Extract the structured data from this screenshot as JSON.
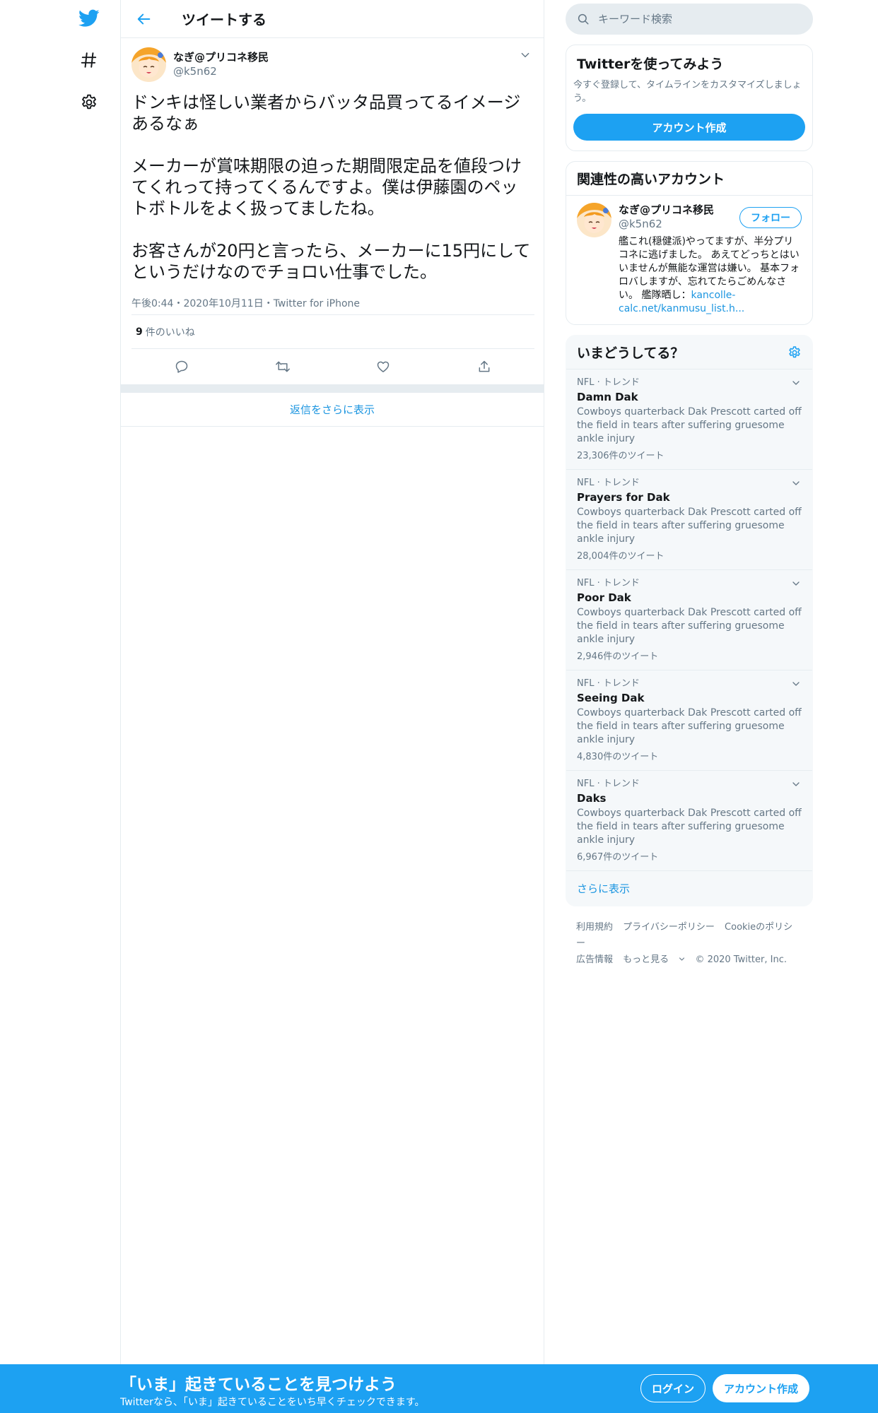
{
  "icons": {
    "twitter": "twitter-bird-icon",
    "explore": "hashtag-icon",
    "settings": "gear-icon"
  },
  "colors": {
    "brand": "#1da1f2",
    "link": "#1b95e0",
    "secondary_text": "#657786",
    "border": "#e6ecf0"
  },
  "header": {
    "title": "ツイートする"
  },
  "tweet": {
    "author_name": "なぎ@プリコネ移民",
    "author_handle": "@k5n62",
    "text": "ドンキは怪しい業者からバッタ品買ってるイメージあるなぁ\n\nメーカーが賞味期限の迫った期間限定品を値段つけてくれって持ってくるんですよ。僕は伊藤園のペットボトルをよく扱ってましたね。\n\nお客さんが20円と言ったら、メーカーに15円にしてというだけなのでチョロい仕事でした。",
    "meta": "午後0:44・2020年10月11日・Twitter for iPhone",
    "like_count": "9",
    "like_label": "件のいいね"
  },
  "more_replies": "返信をさらに表示",
  "search": {
    "placeholder": "キーワード検索"
  },
  "signup_card": {
    "title": "Twitterを使ってみよう",
    "description": "今すぐ登録して、タイムラインをカスタマイズしましょう。",
    "button": "アカウント作成"
  },
  "related": {
    "title": "関連性の高いアカウント",
    "name": "なぎ@プリコネ移民",
    "handle": "@k5n62",
    "follow": "フォロー",
    "bio": "艦これ(穏健派)やってますが、半分プリコネに逃げました。 あえてどっちとはいいませんが無能な運営は嫌い。 基本フォロバしますが、忘れてたらごめんなさい。 艦隊晒し：",
    "bio_link": "kancolle-calc.net/kanmusu_list.h..."
  },
  "trends": {
    "title": "いまどうしてる？",
    "items": [
      {
        "context": "NFL · トレンド",
        "name": "Damn Dak",
        "desc": "Cowboys quarterback Dak Prescott carted off the field in tears after suffering gruesome ankle injury",
        "count": "23,306件のツイート"
      },
      {
        "context": "NFL · トレンド",
        "name": "Prayers for Dak",
        "desc": "Cowboys quarterback Dak Prescott carted off the field in tears after suffering gruesome ankle injury",
        "count": "28,004件のツイート"
      },
      {
        "context": "NFL · トレンド",
        "name": "Poor Dak",
        "desc": "Cowboys quarterback Dak Prescott carted off the field in tears after suffering gruesome ankle injury",
        "count": "2,946件のツイート"
      },
      {
        "context": "NFL · トレンド",
        "name": "Seeing Dak",
        "desc": "Cowboys quarterback Dak Prescott carted off the field in tears after suffering gruesome ankle injury",
        "count": "4,830件のツイート"
      },
      {
        "context": "NFL · トレンド",
        "name": "Daks",
        "desc": "Cowboys quarterback Dak Prescott carted off the field in tears after suffering gruesome ankle injury",
        "count": "6,967件のツイート"
      }
    ],
    "more": "さらに表示"
  },
  "footer": {
    "terms": "利用規約",
    "privacy": "プライバシーポリシー",
    "cookies": "Cookieのポリシー",
    "ads": "広告情報",
    "more": "もっと見る",
    "copyright": "© 2020 Twitter, Inc."
  },
  "banner": {
    "title": "「いま」起きていることを見つけよう",
    "subtitle": "Twitterなら、「いま」起きていることをいち早くチェックできます。",
    "login": "ログイン",
    "signup": "アカウント作成"
  }
}
